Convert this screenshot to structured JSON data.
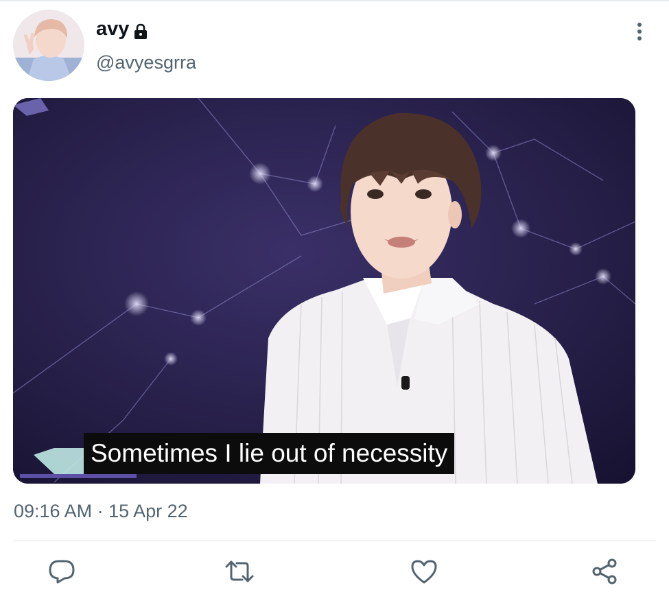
{
  "tweet": {
    "display_name": "avy",
    "handle": "@avyesgrra",
    "caption": "Sometimes I lie out of necessity",
    "timestamp": "09:16 AM · 15 Apr 22"
  },
  "icons": {
    "lock": "lock-icon",
    "more": "more-vertical-icon",
    "reply": "reply-icon",
    "retweet": "retweet-icon",
    "like": "heart-icon",
    "share": "share-icon"
  },
  "colors": {
    "text_primary": "#0f1419",
    "text_secondary": "#536471",
    "icon_gray": "#536471",
    "divider": "#e1e5e8"
  }
}
